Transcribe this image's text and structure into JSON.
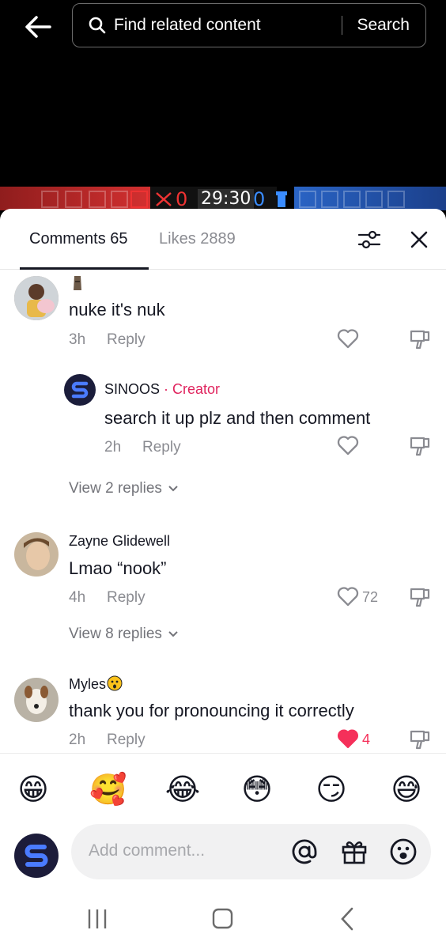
{
  "header": {
    "search_placeholder": "Find related content",
    "search_button": "Search"
  },
  "hud": {
    "left_score": "0",
    "timer": "29:30",
    "right_score": "0"
  },
  "tabs": {
    "comments_label": "Comments 65",
    "likes_label": "Likes 2889"
  },
  "comments": [
    {
      "username": "",
      "text": "nuke it's nuk",
      "time": "3h",
      "reply": "Reply",
      "likes": "",
      "liked": false
    },
    {
      "username": "SINOOS",
      "badge": " · Creator",
      "text": "search it up plz and then comment",
      "time": "2h",
      "reply": "Reply",
      "likes": "",
      "liked": false
    },
    {
      "username": "Zayne Glidewell",
      "text": "Lmao “nook”",
      "time": "4h",
      "reply": "Reply",
      "likes": "72",
      "liked": false
    },
    {
      "username": "Myles",
      "text": "thank you for pronouncing it correctly",
      "time": "2h",
      "reply": "Reply",
      "likes": "4",
      "liked": true
    }
  ],
  "view_replies": [
    "View 2 replies",
    "View 8 replies"
  ],
  "emojis": [
    "😁",
    "🥰",
    "😂",
    "😳",
    "😏",
    "😅"
  ],
  "composer": {
    "placeholder": "Add comment..."
  },
  "colors": {
    "creator": "#e0245e",
    "liked_heart": "#f5305a",
    "secondary_text": "#8a8b91"
  }
}
